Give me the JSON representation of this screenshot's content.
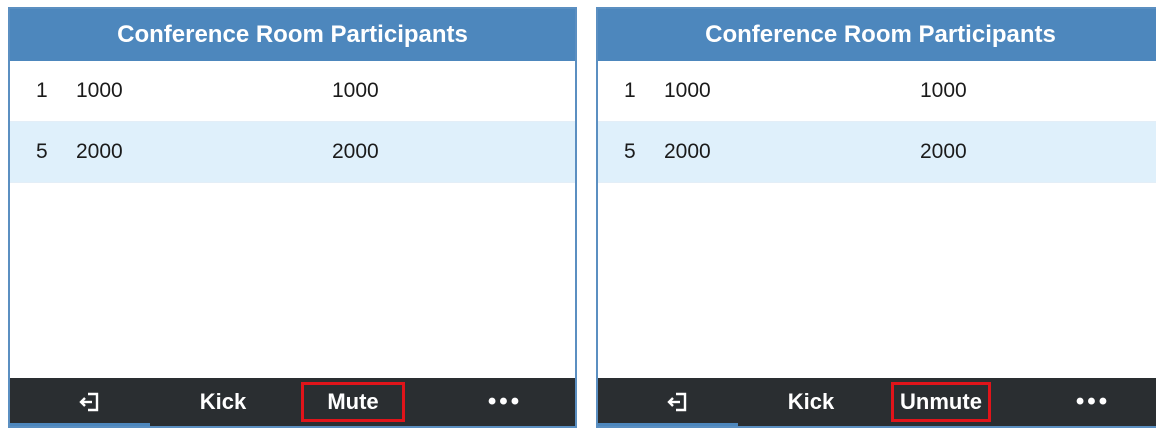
{
  "panels": [
    {
      "title": "Conference Room Participants",
      "participants": [
        {
          "index": "1",
          "number": "1000",
          "name": "1000"
        },
        {
          "index": "5",
          "number": "2000",
          "name": "2000"
        }
      ],
      "softkeys": {
        "exit_icon": "exit-icon",
        "kick": "Kick",
        "toggle": "Mute",
        "more": "•••"
      }
    },
    {
      "title": "Conference Room Participants",
      "participants": [
        {
          "index": "1",
          "number": "1000",
          "name": "1000"
        },
        {
          "index": "5",
          "number": "2000",
          "name": "2000"
        }
      ],
      "softkeys": {
        "exit_icon": "exit-icon",
        "kick": "Kick",
        "toggle": "Unmute",
        "more": "•••"
      }
    }
  ],
  "colors": {
    "titlebar": "#4d87bd",
    "selected_row": "#dff0fb",
    "softkey_bar": "#2a2e31",
    "highlight_box": "#e0141a"
  }
}
